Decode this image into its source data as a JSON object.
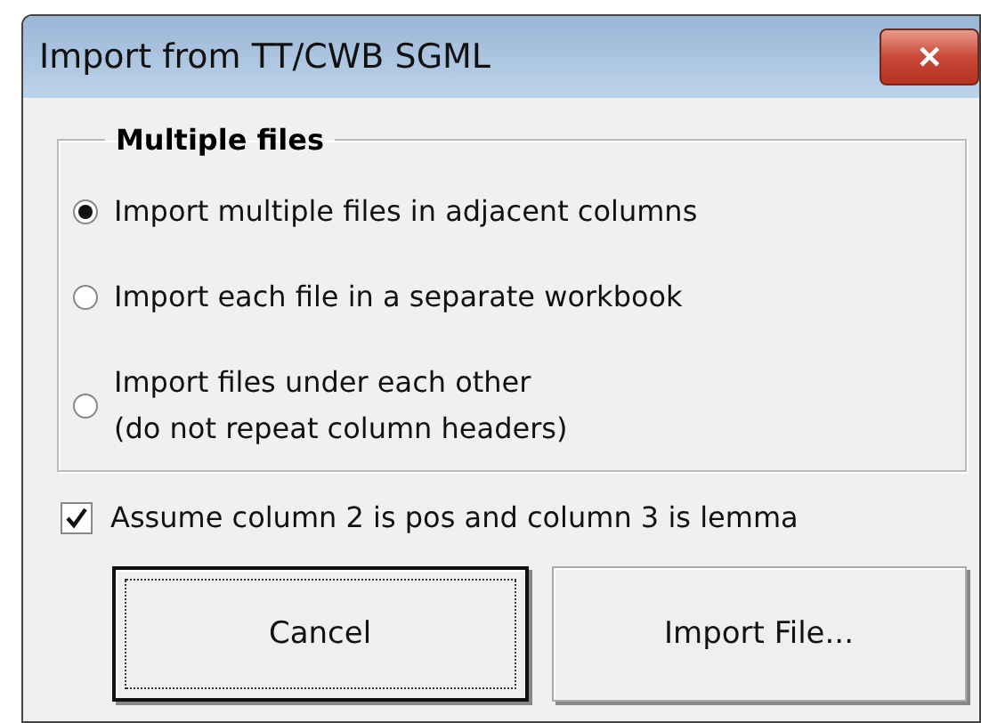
{
  "window": {
    "title": "Import from TT/CWB SGML",
    "close_icon": "✕"
  },
  "group": {
    "legend": "Multiple files",
    "options": [
      {
        "label": "Import multiple files in adjacent columns",
        "selected": true
      },
      {
        "label": "Import each file in a separate workbook",
        "selected": false
      },
      {
        "label": "Import files under each other\n(do not repeat column headers)",
        "selected": false
      }
    ]
  },
  "checkbox": {
    "label": "Assume column 2 is pos and column 3 is lemma",
    "checked": true
  },
  "buttons": [
    {
      "label": "Cancel",
      "default": true
    },
    {
      "label": "Import File...",
      "default": false
    }
  ]
}
